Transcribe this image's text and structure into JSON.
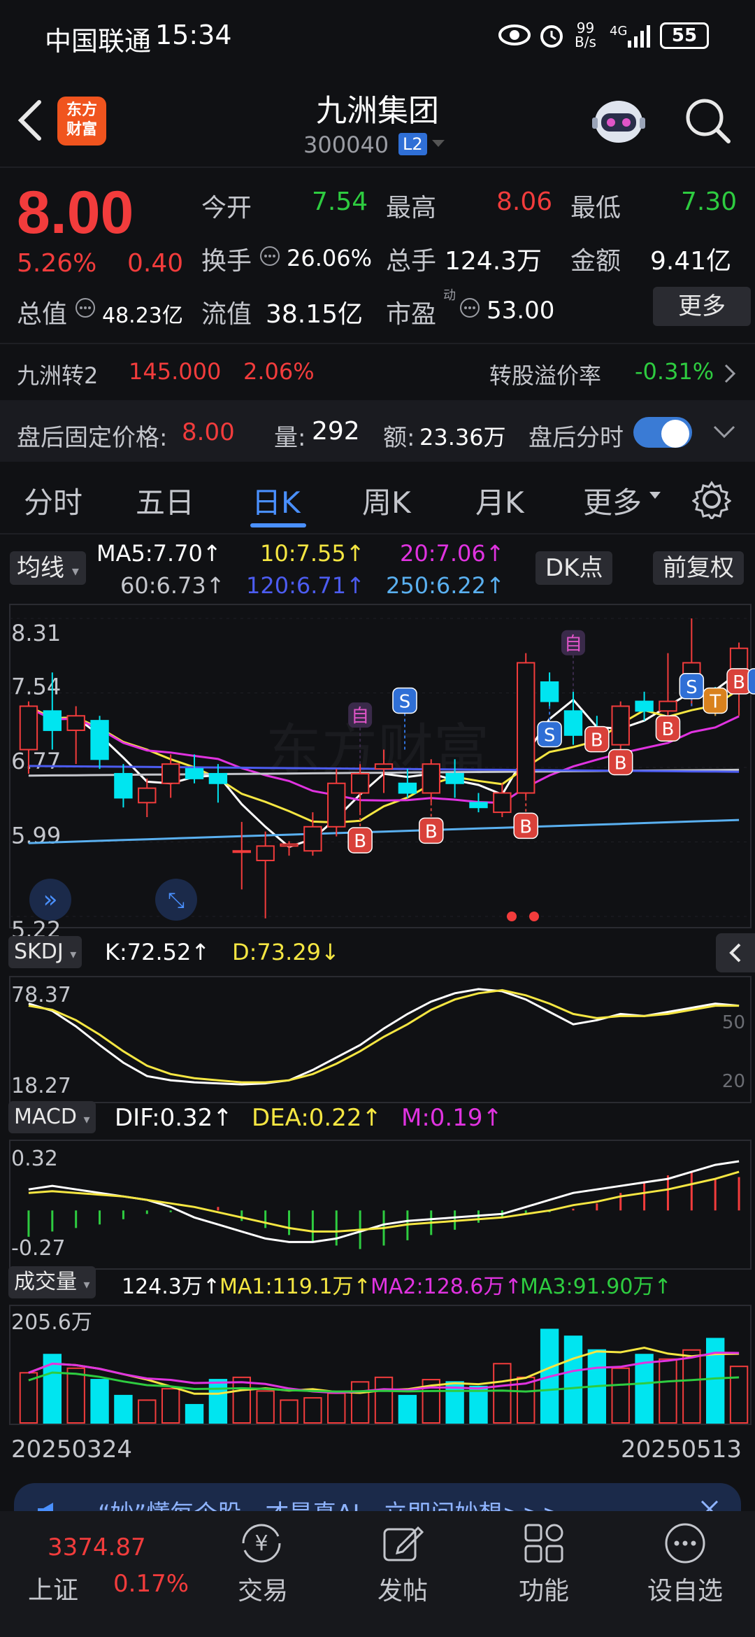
{
  "status": {
    "carrier": "中国联通",
    "time": "15:34",
    "net_speed": "99\nB/s",
    "signal": "4G",
    "battery": "55"
  },
  "header": {
    "logo_text": "东方\n财富",
    "stock_name": "九洲集团",
    "stock_code": "300040",
    "level_badge": "L2"
  },
  "quote": {
    "price": "8.00",
    "change_pct": "5.26%",
    "change_amt": "0.40",
    "open_label": "今开",
    "open": "7.54",
    "high_label": "最高",
    "high": "8.06",
    "low_label": "最低",
    "low": "7.30",
    "turnover_label": "换手",
    "turnover": "26.06%",
    "volume_label": "总手",
    "volume": "124.3万",
    "amount_label": "金额",
    "amount": "9.41亿",
    "mktcap_label": "总值",
    "mktcap": "48.23亿",
    "float_label": "流值",
    "float_cap": "38.15亿",
    "pe_label": "市盈",
    "pe_sup": "动",
    "pe": "53.00",
    "more_button": "更多"
  },
  "bond": {
    "name": "九洲转2",
    "price": "145.000",
    "pct": "2.06%",
    "premium_label": "转股溢价率",
    "premium": "-0.31%"
  },
  "after_hours": {
    "label": "盘后固定价格:",
    "price": "8.00",
    "vol_label": "量:",
    "vol": "292",
    "amt_label": "额:",
    "amt": "23.36万",
    "toggle_label": "盘后分时"
  },
  "tabs": [
    "分时",
    "五日",
    "日K",
    "周K",
    "月K",
    "更多"
  ],
  "ma_bar": {
    "selector": "均线",
    "ma5": "MA5:7.70↑",
    "ma10": "10:7.55↑",
    "ma20": "20:7.06↑",
    "ma60": "60:6.73↑",
    "ma120": "120:6.71↑",
    "ma250": "250:6.22↑",
    "dk_button": "DK点",
    "adjust_button": "前复权"
  },
  "colors": {
    "up": "#f23c3c",
    "down": "#00e5f0",
    "ma5": "#ffffff",
    "ma10": "#f5e642",
    "ma20": "#e033e0",
    "ma60": "#c4c6cc",
    "ma120": "#4c5cf0",
    "ma250": "#5ab0f0"
  },
  "kline": {
    "y_ticks": [
      "8.31",
      "7.54",
      "6.77",
      "5.99",
      "5.22"
    ],
    "candles": [
      {
        "o": 6.95,
        "h": 7.45,
        "l": 6.7,
        "c": 7.4
      },
      {
        "o": 7.35,
        "h": 7.75,
        "l": 6.95,
        "c": 7.15
      },
      {
        "o": 7.15,
        "h": 7.4,
        "l": 6.8,
        "c": 7.3
      },
      {
        "o": 7.25,
        "h": 7.3,
        "l": 6.75,
        "c": 6.85
      },
      {
        "o": 6.7,
        "h": 6.8,
        "l": 6.35,
        "c": 6.45
      },
      {
        "o": 6.4,
        "h": 6.65,
        "l": 6.25,
        "c": 6.55
      },
      {
        "o": 6.6,
        "h": 6.9,
        "l": 6.45,
        "c": 6.8
      },
      {
        "o": 6.75,
        "h": 6.9,
        "l": 6.6,
        "c": 6.65
      },
      {
        "o": 6.7,
        "h": 6.8,
        "l": 6.4,
        "c": 6.6
      },
      {
        "o": 5.9,
        "h": 6.2,
        "l": 5.5,
        "c": 5.9
      },
      {
        "o": 5.8,
        "h": 6.1,
        "l": 5.2,
        "c": 5.95
      },
      {
        "o": 5.95,
        "h": 6.0,
        "l": 5.85,
        "c": 5.97
      },
      {
        "o": 5.9,
        "h": 6.3,
        "l": 5.85,
        "c": 6.15
      },
      {
        "o": 6.15,
        "h": 6.75,
        "l": 6.05,
        "c": 6.6
      },
      {
        "o": 6.5,
        "h": 6.8,
        "l": 6.3,
        "c": 6.7
      },
      {
        "o": 6.75,
        "h": 6.95,
        "l": 6.5,
        "c": 6.8
      },
      {
        "o": 6.6,
        "h": 6.75,
        "l": 6.45,
        "c": 6.5
      },
      {
        "o": 6.5,
        "h": 6.85,
        "l": 6.4,
        "c": 6.8
      },
      {
        "o": 6.7,
        "h": 6.85,
        "l": 6.45,
        "c": 6.6
      },
      {
        "o": 6.4,
        "h": 6.5,
        "l": 6.3,
        "c": 6.35
      },
      {
        "o": 6.3,
        "h": 6.6,
        "l": 6.25,
        "c": 6.5
      },
      {
        "o": 6.5,
        "h": 7.95,
        "l": 6.45,
        "c": 7.85
      },
      {
        "o": 7.65,
        "h": 7.75,
        "l": 7.4,
        "c": 7.45
      },
      {
        "o": 7.35,
        "h": 7.55,
        "l": 7.0,
        "c": 7.1
      },
      {
        "o": 7.1,
        "h": 7.3,
        "l": 6.95,
        "c": 7.0
      },
      {
        "o": 7.0,
        "h": 7.45,
        "l": 6.95,
        "c": 7.4
      },
      {
        "o": 7.45,
        "h": 7.55,
        "l": 7.25,
        "c": 7.35
      },
      {
        "o": 7.35,
        "h": 7.95,
        "l": 7.3,
        "c": 7.45
      },
      {
        "o": 7.55,
        "h": 8.31,
        "l": 7.4,
        "c": 7.85
      },
      {
        "o": 7.5,
        "h": 7.6,
        "l": 7.3,
        "c": 7.4
      },
      {
        "o": 7.6,
        "h": 8.06,
        "l": 7.3,
        "c": 8.0
      }
    ],
    "markers": [
      {
        "i": 14,
        "label": "自",
        "type": "auto",
        "pos": "top"
      },
      {
        "i": 15,
        "label": "S",
        "type": "S",
        "pos": "top"
      },
      {
        "i": 14,
        "label": "B",
        "type": "B",
        "pos": "bottom"
      },
      {
        "i": 17,
        "label": "B",
        "type": "B",
        "pos": "bottom"
      },
      {
        "i": 21,
        "label": "B",
        "type": "B",
        "pos": "bottom"
      },
      {
        "i": 22,
        "label": "S",
        "type": "S",
        "pos": "bottom"
      },
      {
        "i": 23,
        "label": "自",
        "type": "auto",
        "pos": "top"
      },
      {
        "i": 24,
        "label": "B",
        "type": "B",
        "pos": "mid"
      },
      {
        "i": 25,
        "label": "B",
        "type": "B",
        "pos": "low"
      },
      {
        "i": 27,
        "label": "B",
        "type": "B",
        "pos": "low"
      },
      {
        "i": 28,
        "label": "S",
        "type": "S",
        "pos": "mid"
      },
      {
        "i": 29,
        "label": "T",
        "type": "T",
        "pos": "mid"
      },
      {
        "i": 30,
        "label": "B",
        "type": "B",
        "pos": "mid"
      },
      {
        "i": 30,
        "label": "S",
        "type": "S",
        "pos": "mid2"
      }
    ]
  },
  "kdj": {
    "selector": "SKDJ",
    "k": "K:72.52↑",
    "d": "D:73.29↓",
    "y_top": "78.37",
    "y_bottom": "18.27",
    "right_50": "50",
    "right_20": "20"
  },
  "macd": {
    "selector": "MACD",
    "dif": "DIF:0.32↑",
    "dea": "DEA:0.22↑",
    "m": "M:0.19↑",
    "y_top": "0.32",
    "y_bottom": "-0.27",
    "bars": [
      -0.15,
      -0.12,
      -0.1,
      -0.08,
      -0.05,
      -0.02,
      -0.01,
      0.0,
      0.02,
      -0.06,
      -0.1,
      -0.14,
      -0.18,
      -0.2,
      -0.22,
      -0.2,
      -0.17,
      -0.14,
      -0.11,
      -0.07,
      -0.04,
      -0.02,
      -0.01,
      0.01,
      0.04,
      0.1,
      0.16,
      0.2,
      0.22,
      0.18,
      0.19
    ]
  },
  "volume": {
    "selector": "成交量",
    "vol": "124.3万↑",
    "ma1": "MA1:119.1万↑",
    "ma2": "MA2:128.6万↑",
    "ma3": "MA3:91.90万↑",
    "y_top": "205.6万",
    "date_start": "20250324",
    "date_end": "20250513",
    "values": [
      110,
      150,
      120,
      95,
      60,
      50,
      75,
      40,
      95,
      100,
      70,
      50,
      55,
      65,
      90,
      100,
      60,
      95,
      90,
      80,
      130,
      100,
      205,
      190,
      160,
      120,
      150,
      140,
      160,
      185,
      124
    ]
  },
  "banner": {
    "text": "“妙”懂每个股，才是真AI，立即问妙想>>>"
  },
  "bottom_nav": {
    "index_value": "3374.87",
    "index_label": "上证",
    "index_pct": "0.17%",
    "trade": "交易",
    "post": "发帖",
    "function": "功能",
    "watchlist": "设自选"
  }
}
